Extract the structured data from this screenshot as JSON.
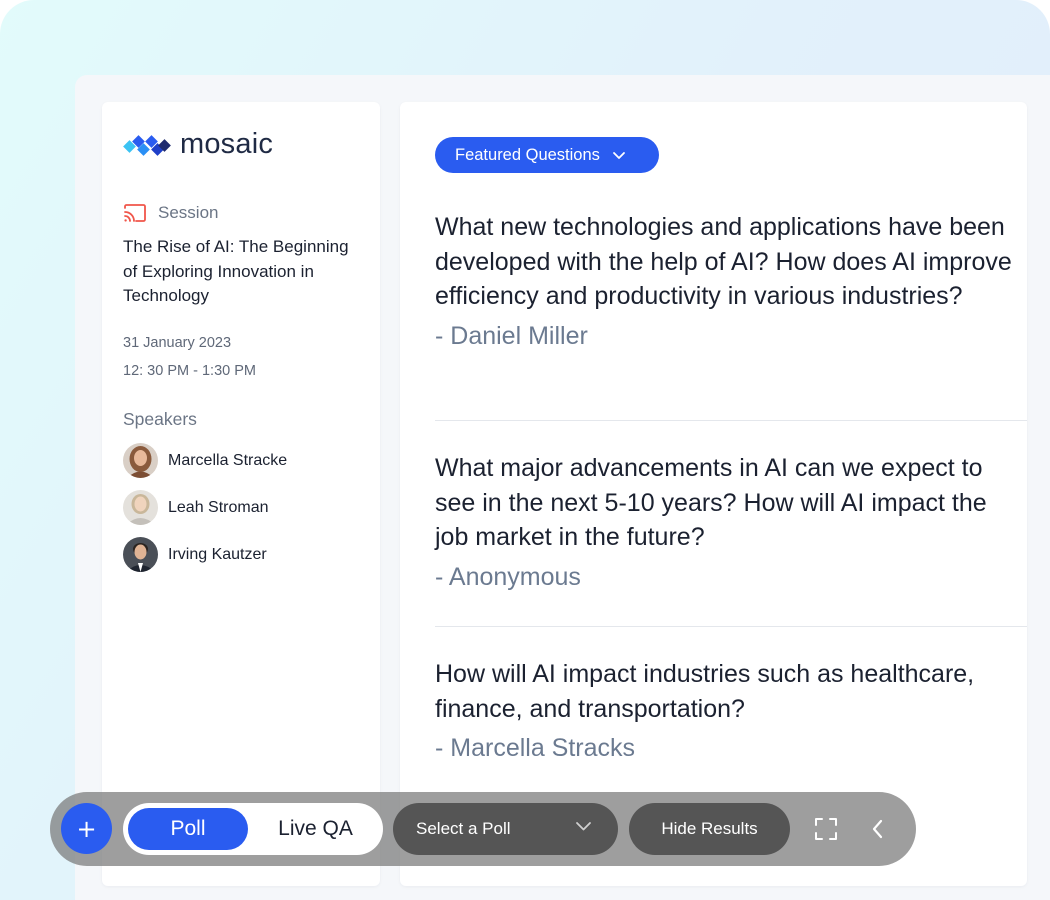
{
  "brand": {
    "name": "mosaic"
  },
  "session": {
    "label": "Session",
    "title": "The Rise of AI: The Beginning of Exploring Innovation in Technology",
    "date": "31 January 2023",
    "time": "12: 30 PM - 1:30 PM"
  },
  "speakers": {
    "label": "Speakers",
    "items": [
      {
        "name": "Marcella Stracke"
      },
      {
        "name": "Leah Stroman"
      },
      {
        "name": "Irving Kautzer"
      }
    ]
  },
  "filter": {
    "label": "Featured Questions"
  },
  "questions": [
    {
      "text": "What new technologies and applications have been developed with the help of AI? How does AI improve efficiency and productivity in various industries?",
      "author": "- Daniel Miller"
    },
    {
      "text": "What major advancements in AI can we expect to see in the next 5-10 years? How will AI impact the job market in the future?",
      "author": "- Anonymous"
    },
    {
      "text": "How will AI impact industries such as healthcare, finance, and transportation?",
      "author": "- Marcella Stracks"
    }
  ],
  "toolbar": {
    "add_label": "+",
    "mode_poll": "Poll",
    "mode_live_qa": "Live QA",
    "select_poll": "Select a Poll",
    "hide_results": "Hide Results"
  },
  "colors": {
    "accent": "#2a5cf0",
    "text": "#1b2130",
    "muted": "#6b7a90",
    "cast": "#f0564a"
  },
  "icons": {
    "cast": "cast-icon",
    "dropdown": "chevron-down-icon",
    "fullscreen": "fullscreen-icon",
    "collapse": "chevron-left-icon"
  }
}
